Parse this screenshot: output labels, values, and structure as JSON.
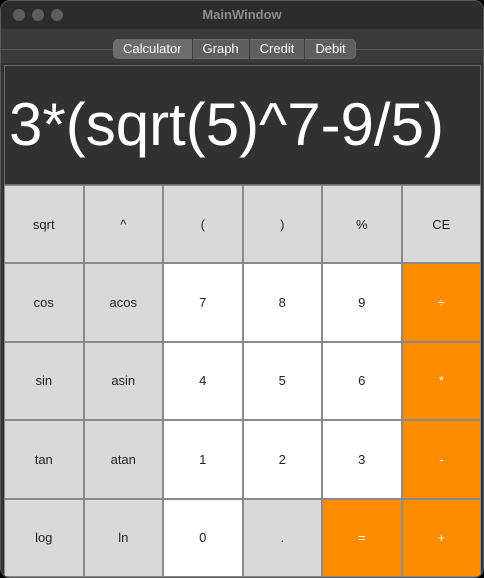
{
  "window": {
    "title": "MainWindow"
  },
  "tabs": [
    {
      "label": "Calculator",
      "active": true
    },
    {
      "label": "Graph",
      "active": false
    },
    {
      "label": "Credit",
      "active": false
    },
    {
      "label": "Debit",
      "active": false
    }
  ],
  "display": {
    "expression": "3*(sqrt(5)^7-9/5)"
  },
  "keys": [
    [
      "sqrt",
      "^",
      "(",
      ")",
      "%",
      "CE"
    ],
    [
      "cos",
      "acos",
      "7",
      "8",
      "9",
      "÷"
    ],
    [
      "sin",
      "asin",
      "4",
      "5",
      "6",
      "*"
    ],
    [
      "tan",
      "atan",
      "1",
      "2",
      "3",
      "-"
    ],
    [
      "log",
      "ln",
      "0",
      ".",
      "=",
      "+"
    ]
  ],
  "colors": {
    "operator": "#ff8c00",
    "digit": "#ffffff",
    "function": "#d9d9d9"
  }
}
